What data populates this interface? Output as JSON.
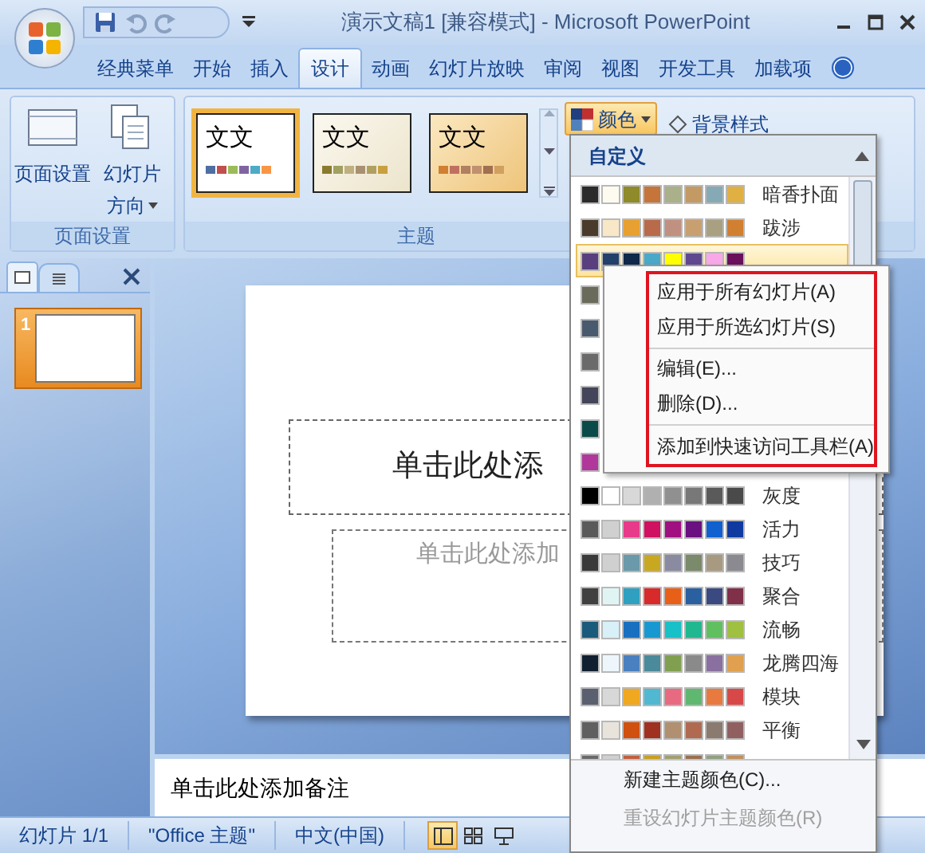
{
  "window": {
    "title": "演示文稿1 [兼容模式] - Microsoft PowerPoint"
  },
  "tabs": [
    {
      "label": "经典菜单",
      "selected": false
    },
    {
      "label": "开始",
      "selected": false
    },
    {
      "label": "插入",
      "selected": false
    },
    {
      "label": "设计",
      "selected": true
    },
    {
      "label": "动画",
      "selected": false
    },
    {
      "label": "幻灯片放映",
      "selected": false
    },
    {
      "label": "审阅",
      "selected": false
    },
    {
      "label": "视图",
      "selected": false
    },
    {
      "label": "开发工具",
      "selected": false
    },
    {
      "label": "加载项",
      "selected": false
    }
  ],
  "page_setup_group": {
    "label": "页面设置",
    "buttons": [
      {
        "lines": [
          "页面设置"
        ],
        "dropdown": false
      },
      {
        "lines": [
          "幻灯片",
          "方向"
        ],
        "dropdown": true
      }
    ]
  },
  "themes_group": {
    "label": "主题",
    "themes": [
      {
        "sample": "文文",
        "kind": "white",
        "selected": true,
        "swatches": [
          {
            "color": "#4f6fa0"
          },
          {
            "color": "#c0504d"
          },
          {
            "color": "#9bbb59"
          },
          {
            "color": "#8064a2"
          },
          {
            "color": "#4bacc6"
          },
          {
            "color": "#f79646"
          }
        ]
      },
      {
        "sample": "文文",
        "kind": "cream",
        "selected": false,
        "swatches": [
          {
            "color": "#8a7a30"
          },
          {
            "color": "#a0a060"
          },
          {
            "color": "#c0b080"
          },
          {
            "color": "#a89070"
          },
          {
            "color": "#b0a060"
          },
          {
            "color": "#c8a040"
          }
        ]
      },
      {
        "sample": "文文",
        "kind": "gold",
        "selected": false,
        "swatches": [
          {
            "color": "#d08030"
          },
          {
            "color": "#c07060"
          },
          {
            "color": "#b08060"
          },
          {
            "color": "#c09070"
          },
          {
            "color": "#a07050"
          },
          {
            "color": "#d0a060"
          }
        ]
      }
    ],
    "colors_button": {
      "label": "颜色"
    },
    "background_styles": {
      "label": "背景样式"
    }
  },
  "colors_menu": {
    "header": "自定义",
    "rows": [
      {
        "name": "暗香扑面",
        "selected": false,
        "swatches": [
          {
            "color": "#2b2b2b"
          },
          {
            "color": "#fdfbf0"
          },
          {
            "color": "#8f8a2a"
          },
          {
            "color": "#c5743a"
          },
          {
            "color": "#a9b08a"
          },
          {
            "color": "#c39a63"
          },
          {
            "color": "#86a9b6"
          },
          {
            "color": "#e0b042"
          }
        ]
      },
      {
        "name": "跋涉",
        "selected": false,
        "swatches": [
          {
            "color": "#4a3a2c"
          },
          {
            "color": "#f8e8c8"
          },
          {
            "color": "#e8a030"
          },
          {
            "color": "#b86a4a"
          },
          {
            "color": "#c09080"
          },
          {
            "color": "#c8a070"
          },
          {
            "color": "#a8a080"
          },
          {
            "color": "#d08030"
          }
        ]
      },
      {
        "selected": true,
        "swatches": [
          {
            "color": "#5a3f7e"
          },
          {
            "color": "#23406a"
          },
          {
            "color": "#10284a"
          },
          {
            "color": "#4aa8c8"
          },
          {
            "color": "#ffff00"
          },
          {
            "color": "#604890"
          },
          {
            "color": "#f8a8e8"
          },
          {
            "color": "#6a0f5a"
          }
        ]
      },
      {
        "selected": false,
        "swatches": [
          {
            "color": "#6b6b5b"
          }
        ]
      },
      {
        "selected": false,
        "swatches": [
          {
            "color": "#4a5a6e"
          }
        ]
      },
      {
        "selected": false,
        "swatches": [
          {
            "color": "#6a6a6a"
          }
        ]
      },
      {
        "selected": false,
        "swatches": [
          {
            "color": "#44445a"
          }
        ]
      },
      {
        "selected": false,
        "swatches": [
          {
            "color": "#0a4a48"
          }
        ]
      },
      {
        "selected": false,
        "swatches": [
          {
            "color": "#b0389a"
          }
        ]
      },
      {
        "name": "灰度",
        "selected": false,
        "swatches": [
          {
            "color": "#000000"
          },
          {
            "color": "#ffffff"
          },
          {
            "color": "#d8d8d8"
          },
          {
            "color": "#b0b0b0"
          },
          {
            "color": "#909090"
          },
          {
            "color": "#787878"
          },
          {
            "color": "#5a5a5a"
          },
          {
            "color": "#4a4a4a"
          }
        ]
      },
      {
        "name": "活力",
        "selected": false,
        "swatches": [
          {
            "color": "#5a5a5a"
          },
          {
            "color": "#d0d0d0"
          },
          {
            "color": "#e83a8a"
          },
          {
            "color": "#d01060"
          },
          {
            "color": "#a01080"
          },
          {
            "color": "#6a1080"
          },
          {
            "color": "#1060d0"
          },
          {
            "color": "#103aa0"
          }
        ]
      },
      {
        "name": "技巧",
        "selected": false,
        "swatches": [
          {
            "color": "#3a3a3a"
          },
          {
            "color": "#d0d0d0"
          },
          {
            "color": "#6a9aaa"
          },
          {
            "color": "#c8a820"
          },
          {
            "color": "#8a8aa0"
          },
          {
            "color": "#7a8a6a"
          },
          {
            "color": "#a89a80"
          },
          {
            "color": "#8a8a90"
          }
        ]
      },
      {
        "name": "聚合",
        "selected": false,
        "swatches": [
          {
            "color": "#404040"
          },
          {
            "color": "#e0f4f4"
          },
          {
            "color": "#30a0c0"
          },
          {
            "color": "#d82a2a"
          },
          {
            "color": "#e86018"
          },
          {
            "color": "#2a60a0"
          },
          {
            "color": "#3a4a80"
          },
          {
            "color": "#803048"
          }
        ]
      },
      {
        "name": "流畅",
        "selected": false,
        "swatches": [
          {
            "color": "#1a5a7a"
          },
          {
            "color": "#d8f0f8"
          },
          {
            "color": "#1a70c0"
          },
          {
            "color": "#1898d0"
          },
          {
            "color": "#18c0c8"
          },
          {
            "color": "#20b890"
          },
          {
            "color": "#60c060"
          },
          {
            "color": "#a0c040"
          }
        ]
      },
      {
        "name": "龙腾四海",
        "selected": false,
        "swatches": [
          {
            "color": "#102030"
          },
          {
            "color": "#eef6fc"
          },
          {
            "color": "#4a80c0"
          },
          {
            "color": "#4a8a9a"
          },
          {
            "color": "#80a050"
          },
          {
            "color": "#8a8a8a"
          },
          {
            "color": "#8a70a0"
          },
          {
            "color": "#e0a050"
          }
        ]
      },
      {
        "name": "模块",
        "selected": false,
        "swatches": [
          {
            "color": "#5a6070"
          },
          {
            "color": "#d8d8d8"
          },
          {
            "color": "#f0a820"
          },
          {
            "color": "#50b8d0"
          },
          {
            "color": "#e86a80"
          },
          {
            "color": "#60b870"
          },
          {
            "color": "#e87a40"
          },
          {
            "color": "#d84848"
          }
        ]
      },
      {
        "name": "平衡",
        "selected": false,
        "swatches": [
          {
            "color": "#606060"
          },
          {
            "color": "#e8e4dc"
          },
          {
            "color": "#d05010"
          },
          {
            "color": "#a03020"
          },
          {
            "color": "#b09070"
          },
          {
            "color": "#b06a50"
          },
          {
            "color": "#8a7a70"
          },
          {
            "color": "#906060"
          }
        ]
      },
      {
        "selected": false,
        "swatches": [
          {
            "color": "#6a6a6a"
          },
          {
            "color": "#d0d0d0"
          },
          {
            "color": "#c06040"
          },
          {
            "color": "#c8a020"
          },
          {
            "color": "#a0a070"
          },
          {
            "color": "#9a7050"
          },
          {
            "color": "#90a080"
          },
          {
            "color": "#c09060"
          }
        ]
      }
    ],
    "footer": [
      {
        "label": "新建主题颜色(C)...",
        "disabled": false
      },
      {
        "label": "重设幻灯片主题颜色(R)",
        "disabled": true
      }
    ]
  },
  "context_menu": {
    "items": [
      {
        "label": "应用于所有幻灯片(A)",
        "separator_before": false
      },
      {
        "label": "应用于所选幻灯片(S)",
        "separator_before": false
      },
      {
        "label": "编辑(E)...",
        "separator_before": true
      },
      {
        "label": "删除(D)...",
        "separator_before": false
      },
      {
        "label": "添加到快速访问工具栏(A)",
        "separator_before": true
      }
    ]
  },
  "slide_pane": {
    "slides": [
      {
        "number": "1",
        "selected": true
      }
    ]
  },
  "slide": {
    "title_placeholder": "单击此处添",
    "subtitle_placeholder": "单击此处添加"
  },
  "notes": {
    "text": "单击此处添加备注"
  },
  "status_bar": {
    "items": [
      "幻灯片 1/1",
      "\"Office 主题\"",
      "中文(中国)"
    ],
    "views": [
      {
        "selected": true
      },
      {
        "selected": false
      },
      {
        "selected": false
      }
    ]
  }
}
